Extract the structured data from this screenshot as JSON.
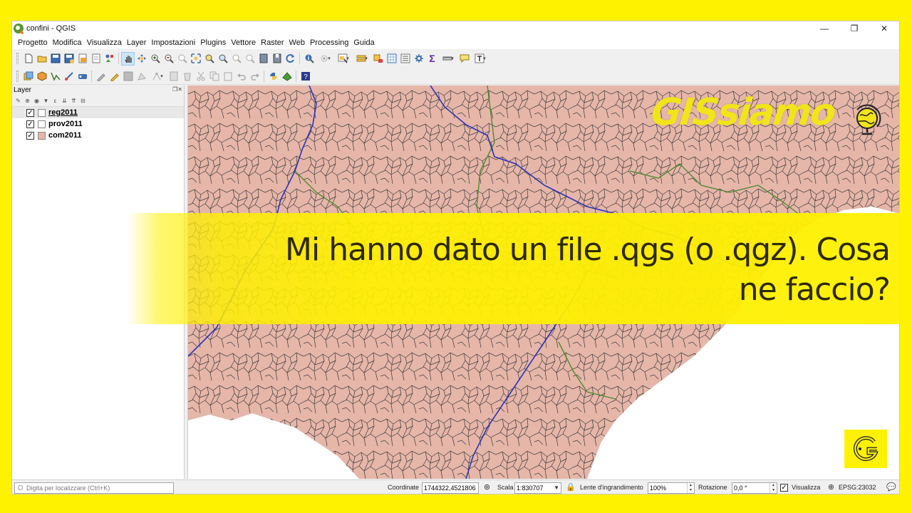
{
  "window": {
    "title": "confini - QGIS",
    "controls": {
      "minimize": "—",
      "maximize": "❐",
      "close": "✕"
    }
  },
  "menu": [
    "Progetto",
    "Modifica",
    "Visualizza",
    "Layer",
    "Impostazioni",
    "Plugins",
    "Vettore",
    "Raster",
    "Web",
    "Processing",
    "Guida"
  ],
  "toolbar_icons": {
    "row1": [
      "new-project-icon",
      "open-project-icon",
      "save-project-icon",
      "save-as-icon",
      "revert-icon",
      "print-layout-icon",
      "style-manager-icon",
      "pan-icon",
      "pan-to-selection-icon",
      "zoom-in-icon",
      "zoom-out-icon",
      "zoom-native-icon",
      "zoom-full-icon",
      "zoom-to-selection-icon",
      "zoom-to-layer-icon",
      "zoom-last-icon",
      "zoom-next-icon",
      "new-bookmark-icon",
      "show-bookmarks-icon",
      "refresh-icon",
      "identify-icon",
      "select-features-icon",
      "select-value-icon",
      "deselect-icon",
      "attribute-table-icon",
      "field-calculator-icon",
      "processing-toolbox-icon",
      "statistics-icon",
      "measure-icon",
      "map-tips-icon",
      "text-annotation-icon"
    ],
    "row2": [
      "data-source-manager-icon",
      "new-geopackage-layer-icon",
      "add-vector-layer-icon",
      "digitize-icon",
      "save-edits-icon",
      "current-edits-icon",
      "toggle-editing-icon",
      "save-layer-edits-icon",
      "add-feature-icon",
      "vertex-tool-icon",
      "delete-selected-icon",
      "cut-features-icon",
      "copy-features-icon",
      "paste-features-icon",
      "undo-icon",
      "redo-icon",
      "python-console-icon",
      "plugin-icon",
      "help-icon"
    ]
  },
  "layers_panel": {
    "title": "Layer",
    "items": [
      {
        "name": "reg2011",
        "checked": "✓",
        "fill": "#ffffff",
        "selected": true
      },
      {
        "name": "prov2011",
        "checked": "✓",
        "fill": "#ffffff",
        "selected": false
      },
      {
        "name": "com2011",
        "checked": "✓",
        "fill": "#e6b6a9",
        "selected": false
      }
    ]
  },
  "map": {
    "fill": "#e6b6a9",
    "municipal_border": "#3a3a3a",
    "province_border": "#4f8a2f",
    "region_border": "#2a35b8"
  },
  "statusbar": {
    "locator_placeholder": "Digita per localizzare (Ctrl+K)",
    "coord_label": "Coordinate",
    "coord_value": "1744322,4521806",
    "scale_label": "Scala",
    "scale_value": "1:830707",
    "magnifier_label": "Lente d'ingrandimento",
    "magnifier_value": "100%",
    "rotation_label": "Rotazione",
    "rotation_value": "0,0 °",
    "render_label": "Visualizza",
    "render_checked": "✓",
    "crs": "EPSG:23032"
  },
  "overlay": {
    "headline_line1": "Mi hanno dato un file .qgs (o .qgz). Cosa",
    "headline_line2": "ne faccio?",
    "brand_text": "GISsiamo",
    "banner_color": "#fff200"
  }
}
